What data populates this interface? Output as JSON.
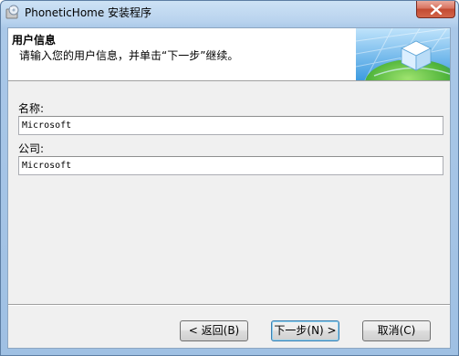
{
  "window": {
    "title": "PhoneticHome 安装程序"
  },
  "header": {
    "title": "用户信息",
    "subtitle": "请输入您的用户信息，并单击“下一步”继续。"
  },
  "form": {
    "name_label": "名称:",
    "name_value": "Microsoft",
    "company_label": "公司:",
    "company_value": "Microsoft"
  },
  "buttons": {
    "back": "< 返回(B)",
    "next": "下一步(N) >",
    "cancel": "取消(C)"
  },
  "icons": {
    "app": "installer-disc-icon",
    "close": "close-icon",
    "banner": "globe-cube-graphic"
  },
  "colors": {
    "titlebar": "#b9d3ee",
    "close_button": "#c24b32",
    "banner_blue": "#2f8fd6",
    "banner_green": "#5cb93b"
  }
}
